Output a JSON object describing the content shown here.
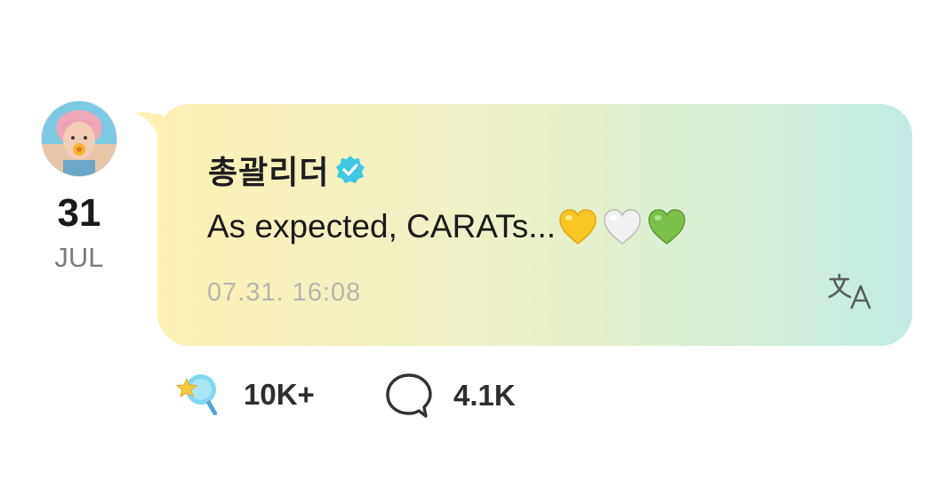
{
  "post": {
    "date": {
      "day": "31",
      "month": "JUL"
    },
    "author": {
      "name": "총괄리더",
      "verified": true
    },
    "message": "As expected, CARATs...",
    "hearts": [
      "yellow-heart",
      "white-heart",
      "green-heart"
    ],
    "timestamp": "07.31. 16:08",
    "reactions": {
      "likes": "10K+",
      "comments": "4.1K"
    }
  },
  "colors": {
    "bubble_gradient": [
      "#fdf1b4",
      "#c3eae4"
    ],
    "verified": "#3fc8e4",
    "timestamp": "#b2b6ae",
    "text": "#1a1a1a"
  },
  "icons": {
    "verified": "verified-badge-icon",
    "translate": "translate-icon",
    "like": "star-wand-icon",
    "comment": "speech-bubble-icon"
  }
}
